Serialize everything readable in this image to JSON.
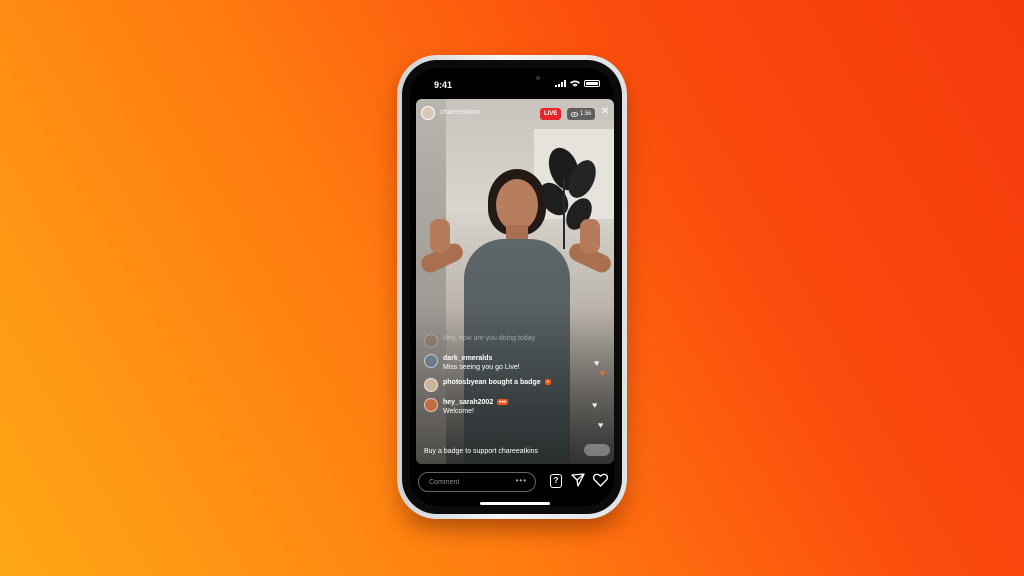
{
  "status_bar": {
    "time": "9:41"
  },
  "stream": {
    "host_name": "chareeatkins",
    "live_label": "LIVE",
    "viewer_count": "1.5k"
  },
  "comments": [
    {
      "user": "",
      "text": "Hey, how are you doing today",
      "faded": true,
      "avatar_color": "#8a6a55"
    },
    {
      "user": "dark_emeralds",
      "text": "Miss seeing you go Live!",
      "faded": false,
      "avatar_color": "#6c7b8a"
    },
    {
      "user": "",
      "text": "photosbyean bought a badge",
      "faded": false,
      "avatar_color": "#c9b49a"
    },
    {
      "user": "hey_sarah2002",
      "text": "Welcome!",
      "faded": false,
      "avatar_color": "#c07040"
    }
  ],
  "support_text": "Buy a badge to support chareeatkins",
  "comment_input": {
    "placeholder": "Comment"
  },
  "colors": {
    "live": "#e8242c",
    "badge": "#f0541e",
    "background_start": "#ffa716",
    "background_end": "#f43a0b"
  }
}
